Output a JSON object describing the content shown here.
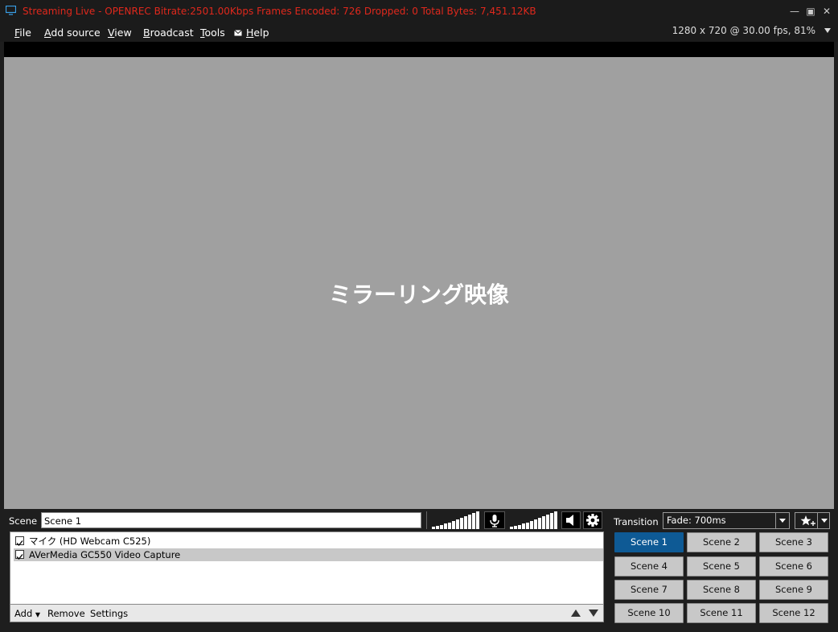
{
  "window": {
    "title": "Streaming Live - OPENREC  Bitrate:2501.00Kbps  Frames Encoded: 726 Dropped: 0  Total Bytes: 7,451.12KB",
    "title_color": "#e0281c"
  },
  "menu": {
    "items": [
      "File",
      "Add source",
      "View",
      "Broadcast",
      "Tools",
      "Help"
    ],
    "resolution": "1280 x 720 @ 30.00 fps, 81%"
  },
  "preview": {
    "label": "ミラーリング映像",
    "background": "#a0a0a0"
  },
  "scene_bar": {
    "label": "Scene",
    "value": "Scene 1"
  },
  "sources": {
    "items": [
      {
        "label": "マイク (HD Webcam C525)",
        "checked": true,
        "selected": false
      },
      {
        "label": "AVerMedia GC550 Video Capture",
        "checked": true,
        "selected": true
      }
    ],
    "toolbar": {
      "add": "Add",
      "remove": "Remove",
      "settings": "Settings"
    }
  },
  "transition": {
    "label": "Transition",
    "value": "Fade: 700ms"
  },
  "scenes": {
    "active": "Scene 1",
    "active_color": "#0e5a95",
    "items": [
      "Scene 1",
      "Scene 2",
      "Scene 3",
      "Scene 4",
      "Scene 5",
      "Scene 6",
      "Scene 7",
      "Scene 8",
      "Scene 9",
      "Scene 10",
      "Scene 11",
      "Scene 12"
    ]
  },
  "icons": {
    "app": "monitor-icon",
    "help": "mail-icon",
    "mic": "microphone-icon",
    "speaker": "speaker-icon",
    "gear": "gear-icon",
    "fx": "star-plus-icon"
  }
}
